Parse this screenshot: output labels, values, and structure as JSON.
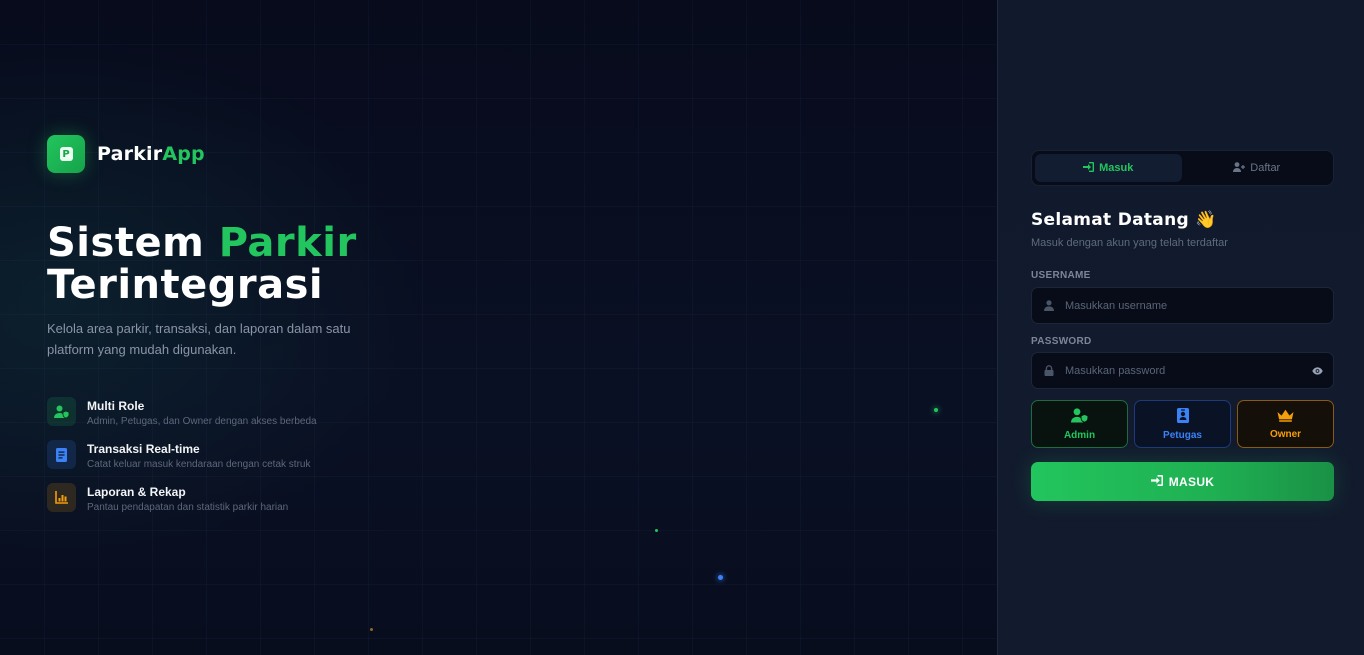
{
  "brand": {
    "name_part1": "Parkir",
    "name_part2": "App",
    "logo_icon": "parking-p-icon"
  },
  "hero": {
    "title_line1_part1": "Sistem ",
    "title_line1_part2": "Parkir",
    "title_line2": "Terintegrasi",
    "description": "Kelola area parkir, transaksi, dan laporan dalam satu platform yang mudah digunakan."
  },
  "features": [
    {
      "title": "Multi Role",
      "subtitle": "Admin, Petugas, dan Owner dengan akses berbeda",
      "icon": "users-shield-icon",
      "color": "#22c55e"
    },
    {
      "title": "Transaksi Real-time",
      "subtitle": "Catat keluar masuk kendaraan dengan cetak struk",
      "icon": "receipt-icon",
      "color": "#3b82f6"
    },
    {
      "title": "Laporan & Rekap",
      "subtitle": "Pantau pendapatan dan statistik parkir harian",
      "icon": "chart-icon",
      "color": "#f59e0b"
    }
  ],
  "tabs": {
    "login_label": "Masuk",
    "register_label": "Daftar"
  },
  "form": {
    "welcome_title": "Selamat Datang",
    "welcome_emoji": "👋",
    "welcome_subtitle": "Masuk dengan akun yang telah terdaftar",
    "username_label": "USERNAME",
    "username_placeholder": "Masukkan username",
    "username_value": "",
    "password_label": "PASSWORD",
    "password_placeholder": "Masukkan password",
    "password_value": "",
    "roles": [
      {
        "label": "Admin",
        "icon": "user-shield-icon",
        "color": "#22c55e"
      },
      {
        "label": "Petugas",
        "icon": "id-badge-icon",
        "color": "#3b82f6"
      },
      {
        "label": "Owner",
        "icon": "crown-icon",
        "color": "#f59e0b"
      }
    ],
    "submit_label": "MASUK"
  },
  "colors": {
    "accent": "#22c55e",
    "blue": "#3b82f6",
    "orange": "#f59e0b",
    "background": "#0a0f1e",
    "panel": "#111a2c"
  }
}
